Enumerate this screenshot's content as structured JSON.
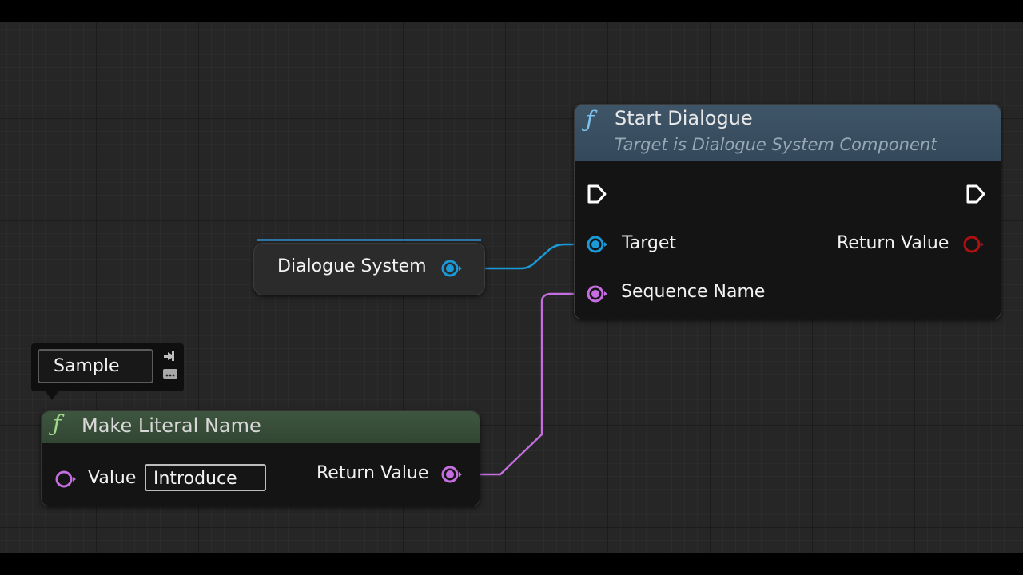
{
  "start_dialogue_node": {
    "title": "Start Dialogue",
    "subtitle": "Target is Dialogue System Component",
    "pins": {
      "target_label": "Target",
      "sequence_name_label": "Sequence Name",
      "return_value_label": "Return Value"
    }
  },
  "variable_node": {
    "label": "Dialogue System"
  },
  "make_literal_node": {
    "title": "Make Literal Name",
    "value_label": "Value",
    "value": "Introduce",
    "return_value_label": "Return Value"
  },
  "comment_bubble": {
    "text": "Sample"
  },
  "colors": {
    "object_pin": "#1a9ad9",
    "name_pin": "#c46ee0",
    "bool_pin": "#b01010",
    "exec_pin": "#ffffff",
    "function_header": "#3a5063",
    "pure_function_header": "#3a503b"
  }
}
